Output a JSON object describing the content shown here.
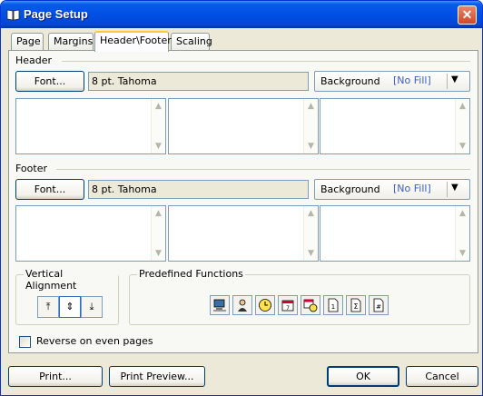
{
  "window": {
    "title": "Page Setup",
    "close_icon": "close-icon"
  },
  "tabs": [
    {
      "label": "Page"
    },
    {
      "label": "Margins"
    },
    {
      "label": "Header\\Footer"
    },
    {
      "label": "Scaling"
    }
  ],
  "active_tab": "Header\\Footer",
  "header": {
    "group_label": "Header",
    "font_button": "Font...",
    "font_value": "8 pt. Tahoma",
    "background_label": "Background",
    "background_value": "[No Fill]"
  },
  "footer": {
    "group_label": "Footer",
    "font_button": "Font...",
    "font_value": "8 pt. Tahoma",
    "background_label": "Background",
    "background_value": "[No Fill]"
  },
  "vertical_alignment": {
    "label": "Vertical Alignment",
    "buttons": [
      "align-top-icon",
      "align-center-icon",
      "align-bottom-icon"
    ],
    "selected": "align-center-icon"
  },
  "predefined_functions": {
    "label": "Predefined Functions",
    "icons": [
      "computer-name-icon",
      "user-name-icon",
      "time-icon",
      "date-icon",
      "date-time-icon",
      "page-number-icon",
      "total-pages-icon",
      "page-of-icon"
    ]
  },
  "reverse_option": {
    "label": "Reverse on even pages",
    "checked": false
  },
  "buttons": {
    "print": "Print...",
    "print_preview": "Print Preview...",
    "ok": "OK",
    "cancel": "Cancel"
  },
  "colors": {
    "titlebar": "#0054e3",
    "dialog_bg": "#ece9d8",
    "no_fill_text": "#3b5ccf"
  }
}
